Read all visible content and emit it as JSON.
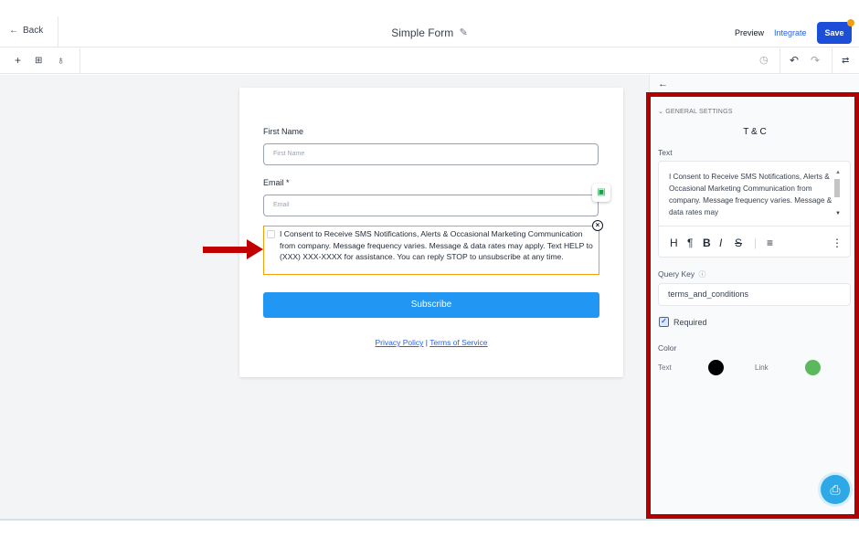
{
  "header": {
    "back_label": "Back",
    "title": "Simple Form",
    "preview_label": "Preview",
    "integrate_label": "Integrate",
    "save_label": "Save"
  },
  "toolbar": {
    "icons": [
      "plus-icon",
      "layers-icon",
      "bell-icon",
      "history-icon",
      "undo-icon",
      "redo-icon",
      "settings-sliders-icon"
    ]
  },
  "form": {
    "first_name_label": "First Name",
    "first_name_placeholder": "First Name",
    "email_label": "Email *",
    "email_placeholder": "Email",
    "consent_text": "I Consent to Receive SMS Notifications, Alerts & Occasional Marketing Communication from company. Message frequency varies. Message & data rates may apply. Text HELP to (XXX) XXX-XXXX for assistance. You can reply STOP to unsubscribe at any time.",
    "subscribe_label": "Subscribe",
    "privacy_label": "Privacy Policy",
    "separator": "|",
    "terms_label": "Terms of Service"
  },
  "panel": {
    "section_header": "GENERAL SETTINGS",
    "title": "T & C",
    "text_label": "Text",
    "editor_text": "I Consent to Receive SMS Notifications, Alerts & Occasional Marketing Communication from company. Message frequency varies. Message & data rates may",
    "format_buttons": {
      "heading": "H",
      "paragraph": "¶",
      "bold": "B",
      "italic": "I",
      "strike": "S"
    },
    "query_key_label": "Query Key",
    "query_key_value": "terms_and_conditions",
    "required_label": "Required",
    "color_label": "Color",
    "text_color_label": "Text",
    "link_color_label": "Link"
  },
  "colors": {
    "text_color": "#000000",
    "link_color": "#5cb85c",
    "accent": "#1d4ed8",
    "annotation": "#b00000"
  }
}
